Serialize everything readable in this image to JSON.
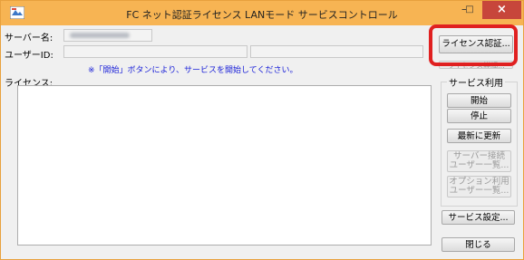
{
  "window": {
    "title": "FC ネット認証ライセンス LANモード サービスコントロール",
    "min_glyph": "–",
    "max_glyph": "□",
    "close_glyph": "×"
  },
  "fields": {
    "server_label": "サーバー名:",
    "userid_label": "ユーザーID:"
  },
  "note": "※「開始」ボタンにより、サービスを開始してください。",
  "license_label": "ライセンス:",
  "buttons": {
    "license_auth": "ライセンス認証...",
    "hidden_row": "ライセンス詳細...",
    "service_group": "サービス利用",
    "start": "開始",
    "stop": "停止",
    "refresh": "最新に更新",
    "server_conn_l1": "サーバー接続",
    "server_conn_l2": "ユーザー一覧...",
    "option_l1": "オプション利用",
    "option_l2": "ユーザー一覧...",
    "service_settings": "サービス設定...",
    "close": "閉じる"
  }
}
